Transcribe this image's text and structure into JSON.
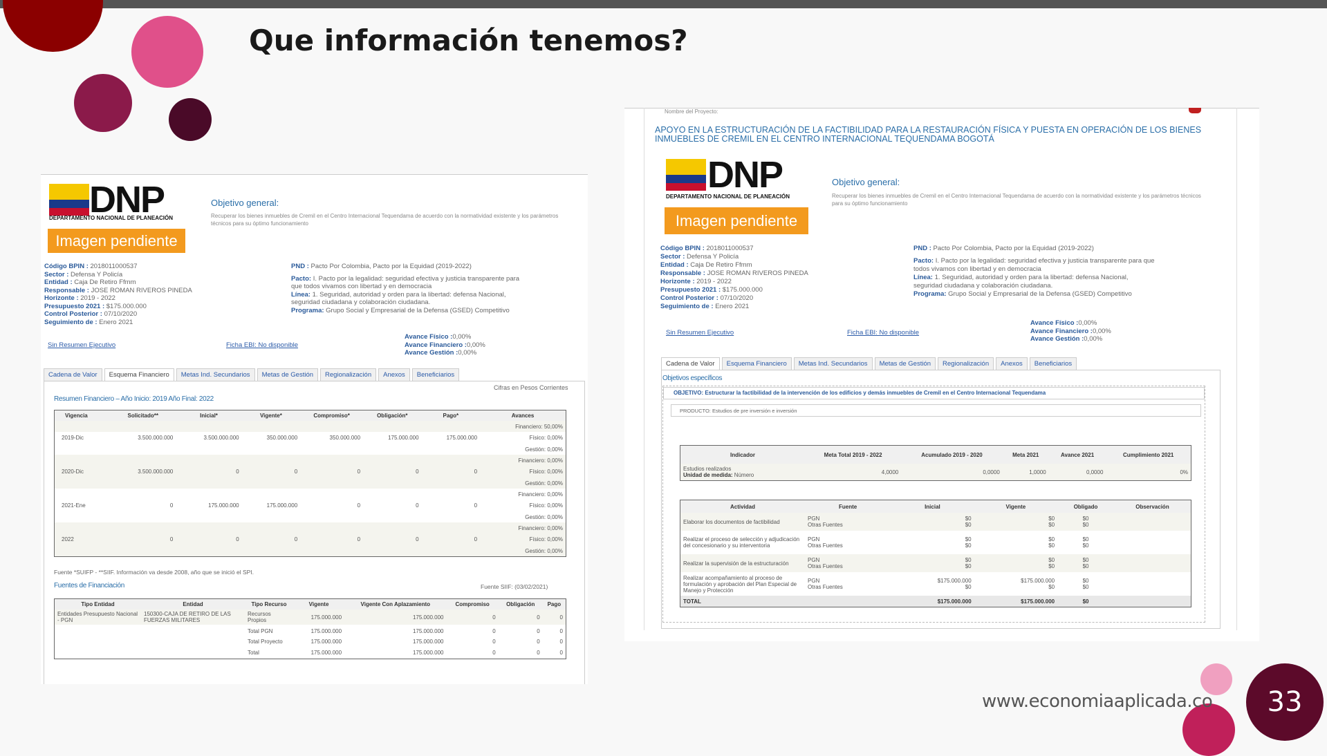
{
  "slide": {
    "title": "Que información tenemos?",
    "footer_url": "www.economiaaplicada.co",
    "page_number": "33",
    "colors": {
      "c1": "#8b0000",
      "c2": "#e0508a",
      "c3": "#8b1a4a",
      "c4": "#4a0a28",
      "c5": "#f0a0c0",
      "c6": "#c0205a"
    }
  },
  "logo": {
    "text": "DNP",
    "subtitle": "DEPARTAMENTO NACIONAL DE PLANEACIÓN",
    "image_pending": "Imagen pendiente"
  },
  "objective": {
    "label": "Objetivo general:",
    "text": "Recuperar los bienes inmuebles de Cremil en el Centro Internacional Tequendama de acuerdo con la normatividad existente y los parámetros técnicos para su óptimo funcionamiento"
  },
  "project": {
    "codigo_label": "Código BPIN :",
    "codigo": "2018011000537",
    "sector_label": "Sector :",
    "sector": "Defensa Y Policía",
    "entidad_label": "Entidad :",
    "entidad": "Caja De Retiro Ffmm",
    "responsable_label": "Responsable :",
    "responsable": "JOSE ROMAN RIVEROS PINEDA",
    "horizonte_label": "Horizonte :",
    "horizonte": "2019 - 2022",
    "presupuesto_label": "Presupuesto 2021 :",
    "presupuesto": "$175.000.000",
    "control_label": "Control Posterior :",
    "control": "07/10/2020",
    "seguimiento_label": "Seguimiento de :",
    "seguimiento": "Enero 2021",
    "pnd_label": "PND :",
    "pnd": "Pacto Por Colombia, Pacto por la Equidad (2019-2022)",
    "pacto_label": "Pacto:",
    "pacto": "I. Pacto por la legalidad: seguridad efectiva y justicia transparente para que todos vivamos con libertad y en democracia",
    "linea_label": "Línea:",
    "linea": "1. Seguridad, autoridad y orden para la libertad: defensa Nacional, seguridad ciudadana y colaboración ciudadana.",
    "programa_label": "Programa:",
    "programa": "Grupo Social y Empresarial de la Defensa (GSED) Competitivo",
    "avance_fisico_label": "Avance Físico :",
    "avance_fisico": "0,00%",
    "avance_fin_label": "Avance Financiero :",
    "avance_fin": "0,00%",
    "avance_gest_label": "Avance Gestión :",
    "avance_gest": "0,00%",
    "sin_resumen": "Sin Resumen Ejecutivo",
    "ficha": "Ficha EBI: No disponible"
  },
  "tabs": [
    "Cadena de Valor",
    "Esquema Financiero",
    "Metas Ind. Secundarios",
    "Metas de Gestión",
    "Regionalización",
    "Anexos",
    "Beneficiarios"
  ],
  "left": {
    "cifras": "Cifras en Pesos Corrientes",
    "resumen_title": "Resumen Financiero – Año Inicio: 2019 Año Final: 2022",
    "headers": [
      "Vigencia",
      "Solicitado**",
      "Inicial*",
      "Vigente*",
      "Compromiso*",
      "Obligación*",
      "Pago*",
      "Avances"
    ],
    "rows": [
      {
        "v": "2019-Dic",
        "sol": "3.500.000.000",
        "ini": "3.500.000.000",
        "vig": "350.000.000",
        "com": "350.000.000",
        "obl": "175.000.000",
        "pag": "175.000.000",
        "fin": "Financiero: 50,00%",
        "fis": "Físico: 0,00%",
        "ges": "Gestión: 0,00%"
      },
      {
        "v": "2020-Dic",
        "sol": "3.500.000.000",
        "ini": "0",
        "vig": "0",
        "com": "0",
        "obl": "0",
        "pag": "0",
        "fin": "Financiero: 0,00%",
        "fis": "Físico: 0,00%",
        "ges": "Gestión: 0,00%"
      },
      {
        "v": "2021-Ene",
        "sol": "0",
        "ini": "175.000.000",
        "vig": "175.000.000",
        "com": "0",
        "obl": "0",
        "pag": "0",
        "fin": "Financiero: 0,00%",
        "fis": "Físico: 0,00%",
        "ges": "Gestión: 0,00%"
      },
      {
        "v": "2022",
        "sol": "0",
        "ini": "0",
        "vig": "0",
        "com": "0",
        "obl": "0",
        "pag": "0",
        "fin": "Financiero: 0,00%",
        "fis": "Físico: 0,00%",
        "ges": "Gestión: 0,00%"
      }
    ],
    "fuente_note": "Fuente *SUIFP - **SIIF. Información va desde 2008, año que se inició el SPI.",
    "fuentes_title": "Fuentes de Financiación",
    "fuente_siif": "Fuente SIIF: (03/02/2021)",
    "f_headers": [
      "Tipo Entidad",
      "Entidad",
      "Tipo Recurso",
      "Vigente",
      "Vigente Con Aplazamiento",
      "Compromiso",
      "Obligación",
      "Pago"
    ],
    "f_rows": [
      {
        "te": "Entidades Presupuesto Nacional - PGN",
        "en": "150300-CAJA DE RETIRO DE LAS FUERZAS MILITARES",
        "tr": "Recursos Propios",
        "vi": "175.000.000",
        "va": "175.000.000",
        "co": "0",
        "ob": "0",
        "pa": "0"
      },
      {
        "te": "",
        "en": "",
        "tr": "Total PGN",
        "vi": "175.000.000",
        "va": "175.000.000",
        "co": "0",
        "ob": "0",
        "pa": "0"
      },
      {
        "te": "",
        "en": "",
        "tr": "Total Proyecto",
        "vi": "175.000.000",
        "va": "175.000.000",
        "co": "0",
        "ob": "0",
        "pa": "0"
      },
      {
        "te": "",
        "en": "",
        "tr": "Total",
        "vi": "175.000.000",
        "va": "175.000.000",
        "co": "0",
        "ob": "0",
        "pa": "0"
      }
    ]
  },
  "right": {
    "nombre_label": "Nombre del Proyecto:",
    "project_title": "APOYO EN LA ESTRUCTURACIÓN DE LA FACTIBILIDAD PARA LA RESTAURACIÓN FÍSICA Y PUESTA EN OPERACIÓN DE LOS BIENES INMUEBLES DE CREMIL EN EL CENTRO INTERNACIONAL TEQUENDAMA BOGOTÁ",
    "obj_especificos": "Objetivos específicos",
    "objetivo": "OBJETIVO: Estructurar la factibilidad de la intervención de los edificios y demás inmuebles de Cremil en el Centro Internacional Tequendama",
    "producto": "PRODUCTO: Estudios de pre inversión e inversión",
    "ind_headers": [
      "Indicador",
      "Meta Total 2019 - 2022",
      "Acumulado 2019 - 2020",
      "Meta 2021",
      "Avance 2021",
      "Cumplimiento 2021"
    ],
    "ind_row": {
      "ind": "Estudios realizados",
      "um_label": "Unidad de medida:",
      "um": "Número",
      "meta": "4,0000",
      "acum": "0,0000",
      "m21": "1,0000",
      "av": "0,0000",
      "cum": "0%"
    },
    "act_headers": [
      "Actividad",
      "Fuente",
      "Inicial",
      "Vigente",
      "Obligado",
      "Observación"
    ],
    "act_rows": [
      {
        "a": "Elaborar los documentos de factibilidad",
        "f1": "PGN",
        "f2": "Otras Fuentes",
        "i1": "$0",
        "i2": "$0",
        "v1": "$0",
        "v2": "$0",
        "o1": "$0",
        "o2": "$0"
      },
      {
        "a": "Realizar el proceso de selección y adjudicación del concesionario y su interventoria",
        "f1": "PGN",
        "f2": "Otras Fuentes",
        "i1": "$0",
        "i2": "$0",
        "v1": "$0",
        "v2": "$0",
        "o1": "$0",
        "o2": "$0"
      },
      {
        "a": "Realizar la supervisión de la estructuración",
        "f1": "PGN",
        "f2": "Otras Fuentes",
        "i1": "$0",
        "i2": "$0",
        "v1": "$0",
        "v2": "$0",
        "o1": "$0",
        "o2": "$0"
      },
      {
        "a": "Realizar acompañamiento al proceso de formulación y aprobación del Plan Especial de Manejo y Protección",
        "f1": "PGN",
        "f2": "Otras Fuentes",
        "i1": "$175.000.000",
        "i2": "$0",
        "v1": "$175.000.000",
        "v2": "$0",
        "o1": "$0",
        "o2": "$0"
      }
    ],
    "total": {
      "label": "TOTAL",
      "i": "$175.000.000",
      "v": "$175.000.000",
      "o": "$0"
    }
  }
}
